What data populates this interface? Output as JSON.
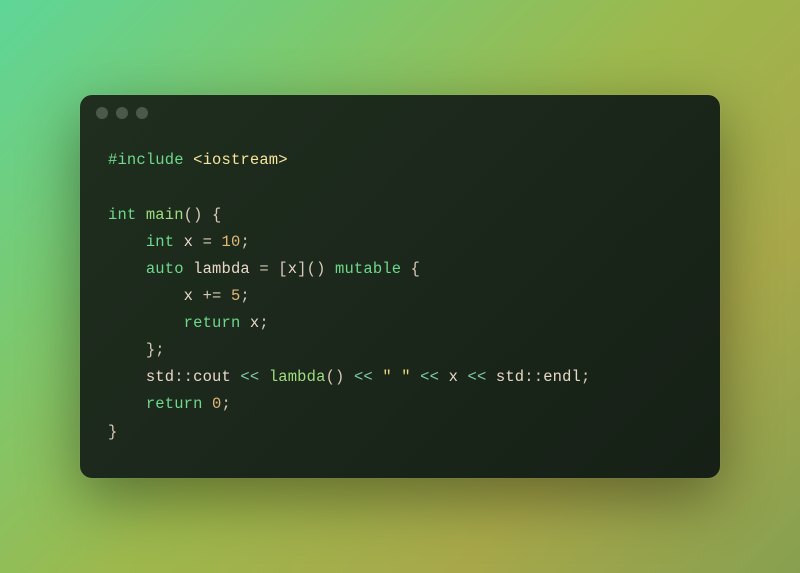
{
  "titlebar": {
    "dots": 3
  },
  "code": {
    "lines": [
      {
        "tokens": [
          {
            "class": "preproc",
            "text": "#include"
          },
          {
            "class": "punct",
            "text": " "
          },
          {
            "class": "header",
            "text": "<iostream>"
          }
        ]
      },
      {
        "tokens": [
          {
            "class": "punct",
            "text": ""
          }
        ]
      },
      {
        "tokens": [
          {
            "class": "keyword",
            "text": "int"
          },
          {
            "class": "punct",
            "text": " "
          },
          {
            "class": "func",
            "text": "main"
          },
          {
            "class": "punct",
            "text": "() {"
          }
        ]
      },
      {
        "tokens": [
          {
            "class": "punct",
            "text": "    "
          },
          {
            "class": "keyword",
            "text": "int"
          },
          {
            "class": "punct",
            "text": " "
          },
          {
            "class": "identifier",
            "text": "x"
          },
          {
            "class": "punct",
            "text": " = "
          },
          {
            "class": "number",
            "text": "10"
          },
          {
            "class": "punct",
            "text": ";"
          }
        ]
      },
      {
        "tokens": [
          {
            "class": "punct",
            "text": "    "
          },
          {
            "class": "keyword",
            "text": "auto"
          },
          {
            "class": "punct",
            "text": " "
          },
          {
            "class": "identifier",
            "text": "lambda"
          },
          {
            "class": "punct",
            "text": " = ["
          },
          {
            "class": "identifier",
            "text": "x"
          },
          {
            "class": "punct",
            "text": "]() "
          },
          {
            "class": "keyword",
            "text": "mutable"
          },
          {
            "class": "punct",
            "text": " {"
          }
        ]
      },
      {
        "tokens": [
          {
            "class": "punct",
            "text": "        "
          },
          {
            "class": "identifier",
            "text": "x"
          },
          {
            "class": "punct",
            "text": " += "
          },
          {
            "class": "number",
            "text": "5"
          },
          {
            "class": "punct",
            "text": ";"
          }
        ]
      },
      {
        "tokens": [
          {
            "class": "punct",
            "text": "        "
          },
          {
            "class": "keyword",
            "text": "return"
          },
          {
            "class": "punct",
            "text": " "
          },
          {
            "class": "identifier",
            "text": "x"
          },
          {
            "class": "punct",
            "text": ";"
          }
        ]
      },
      {
        "tokens": [
          {
            "class": "punct",
            "text": "    };"
          }
        ]
      },
      {
        "tokens": [
          {
            "class": "punct",
            "text": "    "
          },
          {
            "class": "identifier",
            "text": "std"
          },
          {
            "class": "punct",
            "text": "::"
          },
          {
            "class": "identifier",
            "text": "cout"
          },
          {
            "class": "punct",
            "text": " "
          },
          {
            "class": "op",
            "text": "<<"
          },
          {
            "class": "punct",
            "text": " "
          },
          {
            "class": "func",
            "text": "lambda"
          },
          {
            "class": "punct",
            "text": "() "
          },
          {
            "class": "op",
            "text": "<<"
          },
          {
            "class": "punct",
            "text": " "
          },
          {
            "class": "string",
            "text": "\" \""
          },
          {
            "class": "punct",
            "text": " "
          },
          {
            "class": "op",
            "text": "<<"
          },
          {
            "class": "punct",
            "text": " "
          },
          {
            "class": "identifier",
            "text": "x"
          },
          {
            "class": "punct",
            "text": " "
          },
          {
            "class": "op",
            "text": "<<"
          },
          {
            "class": "punct",
            "text": " "
          },
          {
            "class": "identifier",
            "text": "std"
          },
          {
            "class": "punct",
            "text": "::"
          },
          {
            "class": "identifier",
            "text": "endl"
          },
          {
            "class": "punct",
            "text": ";"
          }
        ]
      },
      {
        "tokens": [
          {
            "class": "punct",
            "text": "    "
          },
          {
            "class": "keyword",
            "text": "return"
          },
          {
            "class": "punct",
            "text": " "
          },
          {
            "class": "number",
            "text": "0"
          },
          {
            "class": "punct",
            "text": ";"
          }
        ]
      },
      {
        "tokens": [
          {
            "class": "punct",
            "text": "}"
          }
        ]
      }
    ]
  }
}
